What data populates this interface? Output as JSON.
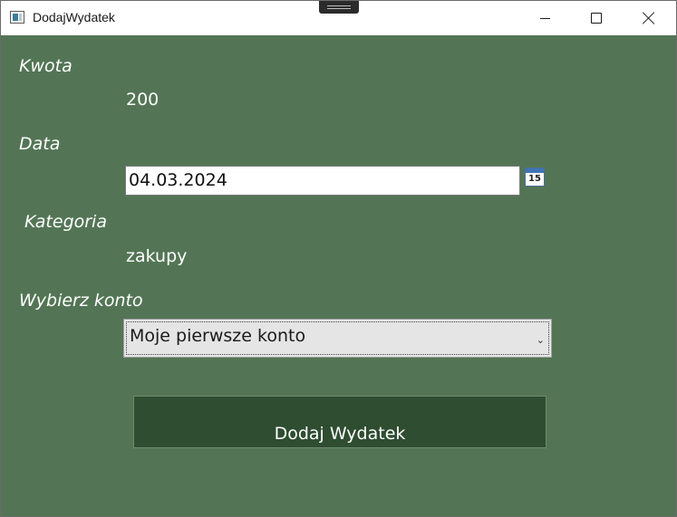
{
  "window": {
    "title": "DodajWydatek"
  },
  "form": {
    "amount_label": "Kwota",
    "amount_value": "200",
    "date_label": "Data",
    "date_value": "04.03.2024",
    "calendar_day": "15",
    "category_label": "Kategoria",
    "category_value": "zakupy",
    "account_label": "Wybierz konto",
    "account_selected": "Moje pierwsze konto",
    "submit_label": "Dodaj Wydatek"
  },
  "icons": {
    "app": "window-app-icon",
    "minimize": "minimize-icon",
    "maximize": "maximize-icon",
    "close": "close-icon",
    "calendar": "calendar-icon",
    "dropdown": "chevron-down-icon"
  },
  "colors": {
    "background": "#537555",
    "button": "#2e4d31",
    "text": "#ffffff"
  }
}
